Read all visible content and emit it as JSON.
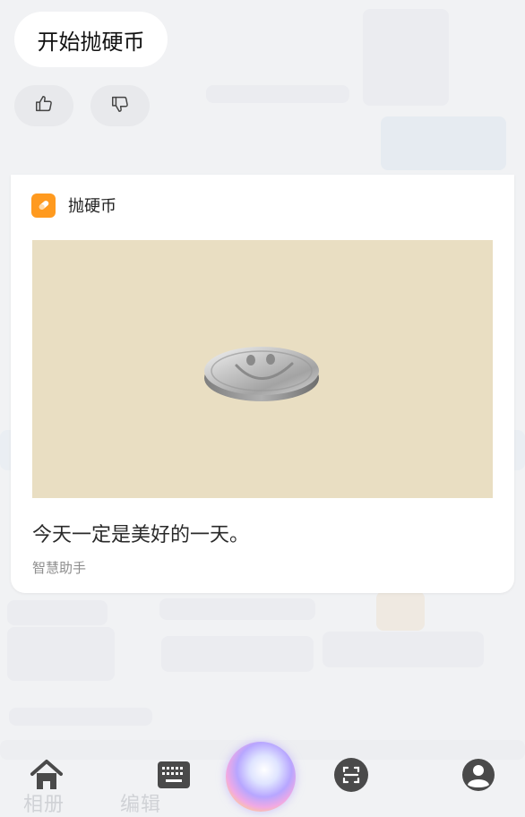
{
  "user_query": "开始抛硬币",
  "feedback": {
    "like_icon": "thumbs-up-icon",
    "dislike_icon": "thumbs-down-icon"
  },
  "card": {
    "app_name": "抛硬币",
    "app_icon": "coin-app-icon",
    "panel_color": "#e9dec2",
    "message": "今天一定是美好的一天。",
    "source": "智慧助手"
  },
  "bottom_nav": {
    "home_icon": "home-icon",
    "keyboard_icon": "keyboard-icon",
    "assistant_icon": "voice-orb-icon",
    "scan_icon": "scan-icon",
    "profile_icon": "profile-icon"
  },
  "background_labels": {
    "album": "相册",
    "edit": "编辑"
  },
  "accent_color": "#ff9a1f"
}
